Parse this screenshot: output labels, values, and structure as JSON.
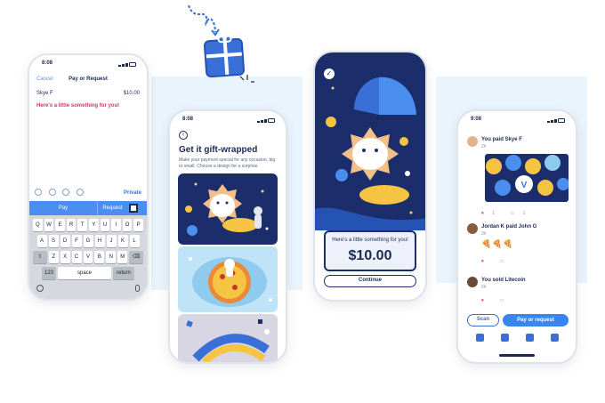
{
  "phone1": {
    "status_time": "8:08",
    "cancel": "Cancel",
    "title": "Pay or Request",
    "recipient": "Skye F",
    "amount": "$10.00",
    "note": "Here's a little something for you!",
    "privacy": "Private",
    "pay_label": "Pay",
    "request_label": "Request",
    "keyboard": {
      "row1": [
        "Q",
        "W",
        "E",
        "R",
        "T",
        "Y",
        "U",
        "I",
        "O",
        "P"
      ],
      "row2": [
        "A",
        "S",
        "D",
        "F",
        "G",
        "H",
        "J",
        "K",
        "L"
      ],
      "row3": [
        "Z",
        "X",
        "C",
        "V",
        "B",
        "N",
        "M"
      ],
      "mode": "123",
      "space": "space",
      "return": "return"
    }
  },
  "phone2": {
    "status_time": "8:08",
    "title": "Get it gift-wrapped",
    "description": "Make your payment special for any occasion, big or small. Choose a design for a surprise."
  },
  "phone3": {
    "message": "Here's a little something for you!",
    "amount": "$10.00",
    "continue": "Continue"
  },
  "phone4": {
    "status_time": "9:08",
    "feed": [
      {
        "title": "You paid Skye F",
        "sub": "2h",
        "likes": "1",
        "comments": "1"
      },
      {
        "title": "Jordan K paid John G",
        "sub": "3h",
        "emoji": "🍕🍕🍕",
        "likes": "",
        "comments": ""
      },
      {
        "title": "You sold Litecoin",
        "sub": "5h",
        "likes": "",
        "comments": ""
      }
    ],
    "scan": "Scan",
    "pay_request": "Pay or request"
  },
  "colors": {
    "navy": "#1c2d6b",
    "blue": "#3a86f0",
    "accent_pink": "#d6336c"
  }
}
